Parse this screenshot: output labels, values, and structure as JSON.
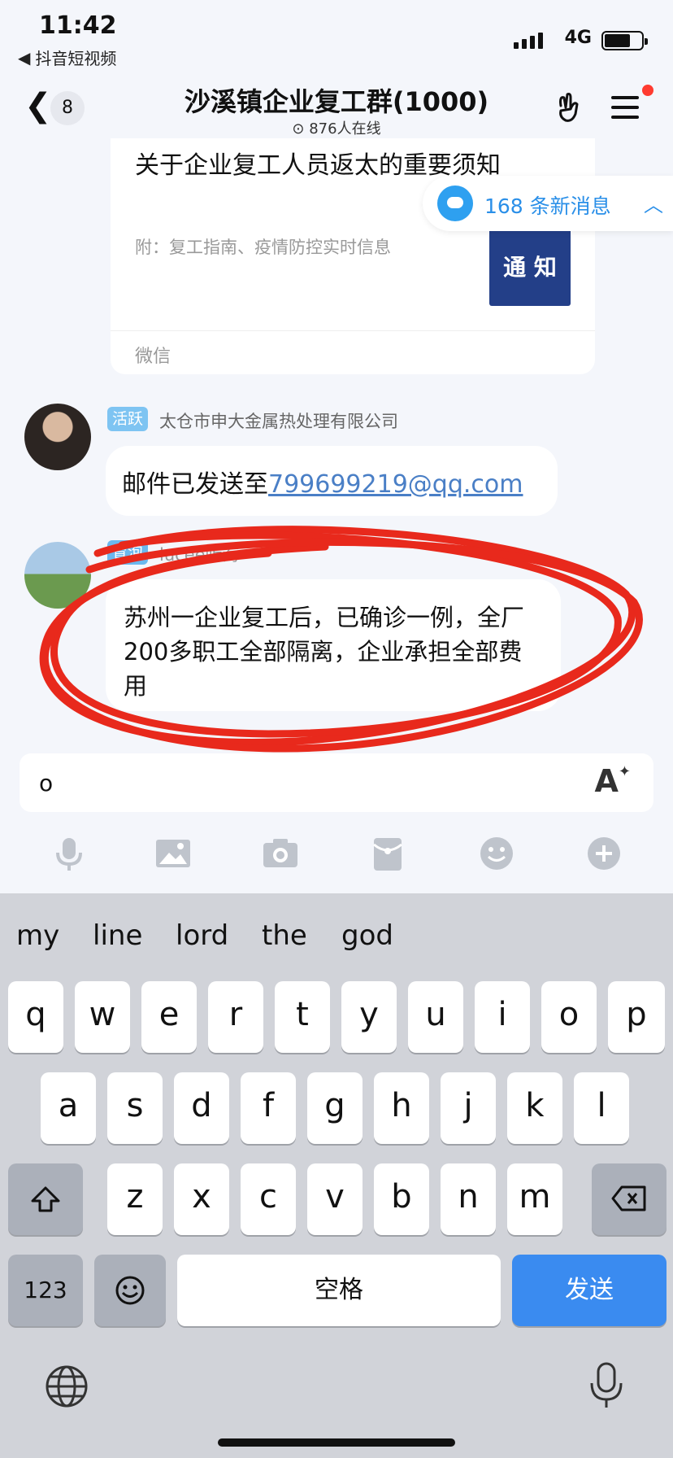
{
  "status_bar": {
    "time": "11:42",
    "back_app": "抖音短视频",
    "network": "4G"
  },
  "nav": {
    "back_count": "8",
    "title": "沙溪镇企业复工群(1000)",
    "online": "876人在线"
  },
  "shared_card": {
    "title": "关于企业复工人员返太的重要须知",
    "desc": "附：复工指南、疫情防控实时信息",
    "thumb_label": "通 知",
    "source": "微信"
  },
  "new_messages": {
    "label": "168 条新消息"
  },
  "messages": [
    {
      "badge": "活跃",
      "sender": "太仓市申大金属热处理有限公司",
      "text_lead": "邮件已发送至",
      "text_link": "799699219@qq.com"
    },
    {
      "badge": "冒泡",
      "sender": "lucee听海",
      "text": "苏州一企业复工后，已确诊一例，全厂200多职工全部隔离，企业承担全部费用"
    }
  ],
  "composer": {
    "value": "o"
  },
  "toolbar_icons": [
    "microphone-icon",
    "image-icon",
    "camera-icon",
    "red-packet-icon",
    "emoji-icon",
    "plus-icon"
  ],
  "keyboard": {
    "suggestions": [
      "my",
      "line",
      "lord",
      "the",
      "god"
    ],
    "row1": [
      "q",
      "w",
      "e",
      "r",
      "t",
      "y",
      "u",
      "i",
      "o",
      "p"
    ],
    "row2": [
      "a",
      "s",
      "d",
      "f",
      "g",
      "h",
      "j",
      "k",
      "l"
    ],
    "row3": [
      "z",
      "x",
      "c",
      "v",
      "b",
      "n",
      "m"
    ],
    "numbers_key": "123",
    "space_key": "空格",
    "send_key": "发送"
  },
  "colors": {
    "accent": "#2a8fe8",
    "send": "#3a8bf0",
    "annotation": "#e8291c"
  }
}
